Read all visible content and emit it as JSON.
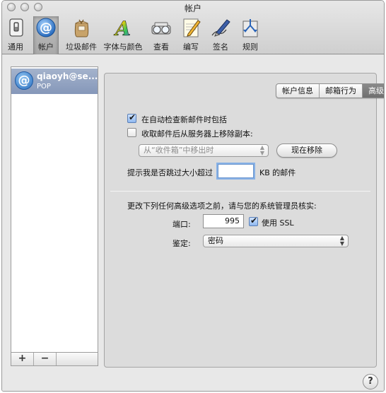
{
  "window": {
    "title": "帐户"
  },
  "toolbar": {
    "items": [
      {
        "label": "通用",
        "icon": "switch-icon"
      },
      {
        "label": "帐户",
        "icon": "at-sign-icon",
        "selected": true
      },
      {
        "label": "垃圾邮件",
        "icon": "junk-bag-icon"
      },
      {
        "label": "字体与颜色",
        "icon": "font-a-icon"
      },
      {
        "label": "查看",
        "icon": "glasses-icon"
      },
      {
        "label": "编写",
        "icon": "notepad-pencil-icon"
      },
      {
        "label": "签名",
        "icon": "pen-icon"
      },
      {
        "label": "规则",
        "icon": "rules-arrows-icon"
      }
    ]
  },
  "accounts": {
    "items": [
      {
        "name": "qiaoyh@se...",
        "type": "POP"
      }
    ],
    "add_label": "+",
    "remove_label": "−"
  },
  "tabs": [
    {
      "label": "帐户信息",
      "active": false
    },
    {
      "label": "邮箱行为",
      "active": false
    },
    {
      "label": "高级",
      "active": true
    }
  ],
  "advanced": {
    "include_auto_check": {
      "label": "在自动检查新邮件时包括",
      "checked": true
    },
    "remove_copy": {
      "label": "收取邮件后从服务器上移除副本:",
      "checked": false
    },
    "remove_when": {
      "value": "从“收件箱”中移出时",
      "disabled": true
    },
    "remove_now_label": "现在移除",
    "size_prompt_label": "提示我是否跳过大小超过",
    "size_value": "",
    "size_unit": "KB 的邮件",
    "admin_note": "更改下列任何高级选项之前，请与您的系统管理员核实:",
    "port_label": "端口:",
    "port_value": "995",
    "ssl": {
      "label": "使用 SSL",
      "checked": true
    },
    "auth_label": "鉴定:",
    "auth_value": "密码"
  },
  "help_label": "?"
}
